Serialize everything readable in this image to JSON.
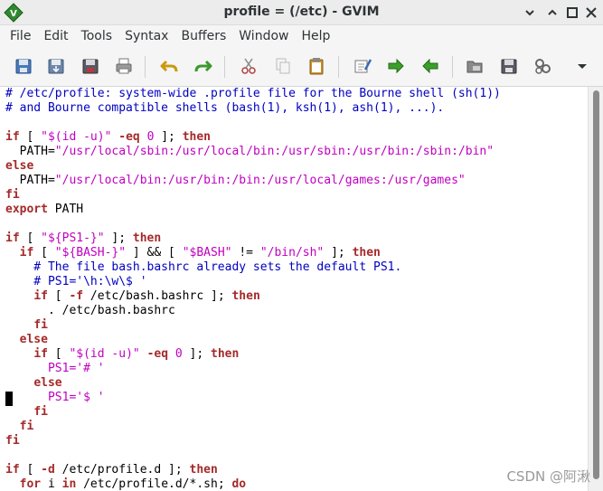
{
  "window": {
    "title": "profile = (/etc) - GVIM"
  },
  "menu": [
    "File",
    "Edit",
    "Tools",
    "Syntax",
    "Buffers",
    "Window",
    "Help"
  ],
  "toolbar": {
    "icons": [
      "open-icon",
      "save-icon",
      "save-all-icon",
      "print-icon",
      "undo-icon",
      "redo-icon",
      "cut-icon",
      "copy-icon",
      "paste-icon",
      "replace-icon",
      "find-next-icon",
      "find-prev-icon",
      "load-session-icon",
      "save-session-icon",
      "run-script-icon",
      "more-icon"
    ]
  },
  "code": [
    [
      [
        "c",
        "# /etc/profile: system-wide .profile file for the Bourne shell (sh(1))"
      ]
    ],
    [
      [
        "c",
        "# and Bourne compatible shells (bash(1), ksh(1), ash(1), ...)."
      ]
    ],
    [],
    [
      [
        "k",
        "if"
      ],
      [
        "p",
        " [ "
      ],
      [
        "s",
        "\"$(id -u)\""
      ],
      [
        "p",
        " "
      ],
      [
        "k",
        "-eq"
      ],
      [
        "p",
        " "
      ],
      [
        "n",
        "0"
      ],
      [
        "p",
        " ]; "
      ],
      [
        "k",
        "then"
      ]
    ],
    [
      [
        "p",
        "  PATH="
      ],
      [
        "s",
        "\"/usr/local/sbin:/usr/local/bin:/usr/sbin:/usr/bin:/sbin:/bin\""
      ]
    ],
    [
      [
        "k",
        "else"
      ]
    ],
    [
      [
        "p",
        "  PATH="
      ],
      [
        "s",
        "\"/usr/local/bin:/usr/bin:/bin:/usr/local/games:/usr/games\""
      ]
    ],
    [
      [
        "k",
        "fi"
      ]
    ],
    [
      [
        "k",
        "export"
      ],
      [
        "p",
        " PATH"
      ]
    ],
    [],
    [
      [
        "k",
        "if"
      ],
      [
        "p",
        " [ "
      ],
      [
        "s",
        "\"${PS1-}\""
      ],
      [
        "p",
        " ]; "
      ],
      [
        "k",
        "then"
      ]
    ],
    [
      [
        "p",
        "  "
      ],
      [
        "k",
        "if"
      ],
      [
        "p",
        " [ "
      ],
      [
        "s",
        "\"${BASH-}\""
      ],
      [
        "p",
        " ] && [ "
      ],
      [
        "s",
        "\"$BASH\""
      ],
      [
        "p",
        " != "
      ],
      [
        "s",
        "\"/bin/sh\""
      ],
      [
        "p",
        " ]; "
      ],
      [
        "k",
        "then"
      ]
    ],
    [
      [
        "c",
        "    # The file bash.bashrc already sets the default PS1."
      ]
    ],
    [
      [
        "c",
        "    # PS1='\\h:\\w\\$ '"
      ]
    ],
    [
      [
        "p",
        "    "
      ],
      [
        "k",
        "if"
      ],
      [
        "p",
        " [ "
      ],
      [
        "k",
        "-f"
      ],
      [
        "p",
        " /etc/bash.bashrc ]; "
      ],
      [
        "k",
        "then"
      ]
    ],
    [
      [
        "p",
        "      . /etc/bash.bashrc"
      ]
    ],
    [
      [
        "p",
        "    "
      ],
      [
        "k",
        "fi"
      ]
    ],
    [
      [
        "p",
        "  "
      ],
      [
        "k",
        "else"
      ]
    ],
    [
      [
        "p",
        "    "
      ],
      [
        "k",
        "if"
      ],
      [
        "p",
        " [ "
      ],
      [
        "s",
        "\"$(id -u)\""
      ],
      [
        "p",
        " "
      ],
      [
        "k",
        "-eq"
      ],
      [
        "p",
        " "
      ],
      [
        "n",
        "0"
      ],
      [
        "p",
        " ]; "
      ],
      [
        "k",
        "then"
      ]
    ],
    [
      [
        "p",
        "      "
      ],
      [
        "s",
        "PS1='# '"
      ]
    ],
    [
      [
        "p",
        "    "
      ],
      [
        "k",
        "else"
      ]
    ],
    [
      [
        "p",
        "      "
      ],
      [
        "s",
        "PS1='$ '"
      ]
    ],
    [
      [
        "p",
        "    "
      ],
      [
        "k",
        "fi"
      ]
    ],
    [
      [
        "p",
        "  "
      ],
      [
        "k",
        "fi"
      ]
    ],
    [
      [
        "k",
        "fi"
      ]
    ],
    [],
    [
      [
        "k",
        "if"
      ],
      [
        "p",
        " [ "
      ],
      [
        "k",
        "-d"
      ],
      [
        "p",
        " /etc/profile.d ]; "
      ],
      [
        "k",
        "then"
      ]
    ],
    [
      [
        "p",
        "  "
      ],
      [
        "k",
        "for"
      ],
      [
        "p",
        " i "
      ],
      [
        "k",
        "in"
      ],
      [
        "p",
        " /etc/profile.d/*.sh; "
      ],
      [
        "k",
        "do"
      ]
    ]
  ],
  "watermark": "CSDN @阿湫"
}
